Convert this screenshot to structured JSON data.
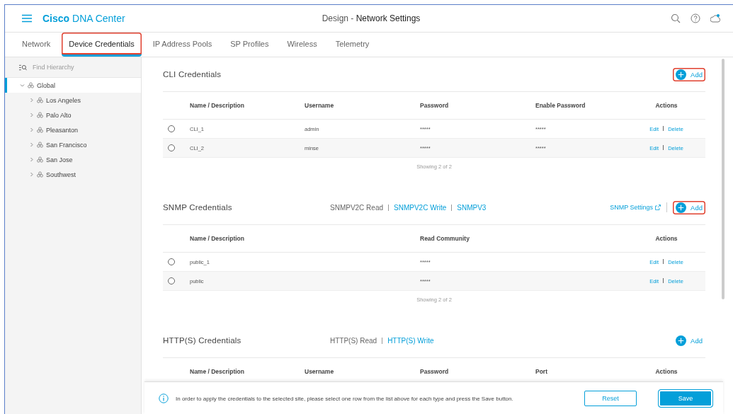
{
  "header": {
    "brand": "**Cisco** DNA Center",
    "title": "Design - **Network Settings**"
  },
  "tabs": [
    {
      "label": "Network",
      "selected": false,
      "highlighted": false
    },
    {
      "label": "Device Credentials",
      "selected": true,
      "highlighted": true
    },
    {
      "label": "IP Address Pools",
      "selected": false,
      "highlighted": false
    },
    {
      "label": "SP Profiles",
      "selected": false,
      "highlighted": false
    },
    {
      "label": "Wireless",
      "selected": false,
      "highlighted": false
    },
    {
      "label": "Telemetry",
      "selected": false,
      "highlighted": false
    }
  ],
  "sidebar": {
    "search": {
      "placeholder": "Find Hierarchy"
    },
    "tree": [
      {
        "label": "Global",
        "expanded": true,
        "selected": true,
        "children": [
          {
            "label": "Los Angeles",
            "expanded": false,
            "selected": false
          },
          {
            "label": "Palo Alto",
            "expanded": false,
            "selected": false
          },
          {
            "label": "Pleasanton",
            "expanded": false,
            "selected": false
          },
          {
            "label": "San Francisco",
            "expanded": false,
            "selected": false
          },
          {
            "label": "San Jose",
            "expanded": false,
            "selected": false
          },
          {
            "label": "Southwest",
            "expanded": false,
            "selected": false
          }
        ]
      }
    ]
  },
  "sections": [
    {
      "title": "CLI Credentials",
      "add": {
        "label": "Add",
        "highlighted": true
      },
      "columns": [
        "Name / Description",
        "Username",
        "Password",
        "Enable Password",
        "Actions"
      ],
      "rows": [
        {
          "selected": false,
          "cells": [
            "CLI_1",
            "admin",
            "*****",
            "*****"
          ],
          "actions": [
            "Edit",
            "Delete"
          ]
        },
        {
          "selected": false,
          "cells": [
            "CLI_2",
            "minse",
            "*****",
            "*****"
          ],
          "actions": [
            "Edit",
            "Delete"
          ]
        }
      ],
      "footer": "Showing 2 of 2"
    },
    {
      "title": "SNMP Credentials",
      "subtabs": [
        {
          "label": "SNMPV2C Read",
          "selected": true
        },
        {
          "label": "SNMPV2C Write",
          "selected": false
        },
        {
          "label": "SNMPV3",
          "selected": false
        }
      ],
      "settings_link": "SNMP Settings",
      "add": {
        "label": "Add",
        "highlighted": true
      },
      "columns": [
        "Name / Description",
        "Read Community",
        "Actions"
      ],
      "rows": [
        {
          "selected": false,
          "cells": [
            "public_1",
            "*****"
          ],
          "actions": [
            "Edit",
            "Delete"
          ]
        },
        {
          "selected": false,
          "cells": [
            "public",
            "*****"
          ],
          "actions": [
            "Edit",
            "Delete"
          ]
        }
      ],
      "footer": "Showing 2 of 2"
    },
    {
      "title": "HTTP(S) Credentials",
      "subtabs": [
        {
          "label": "HTTP(S) Read",
          "selected": true
        },
        {
          "label": "HTTP(S) Write",
          "selected": false
        }
      ],
      "add": {
        "label": "Add",
        "highlighted": false
      },
      "columns": [
        "Name / Description",
        "Username",
        "Password",
        "Port",
        "Actions"
      ]
    }
  ],
  "action_bar": {
    "message": "In order to apply the credentials to the selected site, please select one row from the list above for each type and press the Save button.",
    "buttons": [
      {
        "label": "Reset",
        "kind": "secondary",
        "highlighted": false
      },
      {
        "label": "Save",
        "kind": "primary",
        "highlighted": true
      }
    ]
  }
}
